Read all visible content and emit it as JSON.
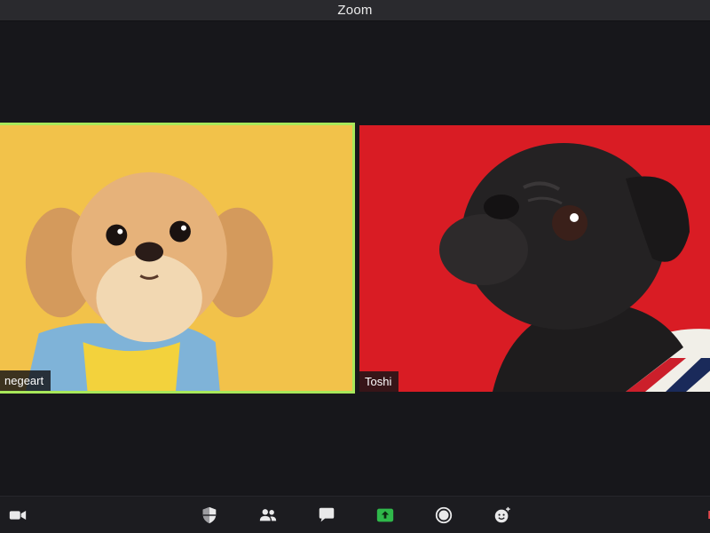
{
  "window": {
    "title": "Zoom"
  },
  "participants": [
    {
      "name": "negeart",
      "tile_color": "#f2c24a",
      "active_speaker": true,
      "highlight_color": "#a8e85a"
    },
    {
      "name": "Toshi",
      "tile_color": "#d91c24",
      "active_speaker": false
    }
  ],
  "toolbar": {
    "icons": [
      {
        "name": "video-camera-icon"
      },
      {
        "name": "security-shield-icon"
      },
      {
        "name": "participants-icon"
      },
      {
        "name": "chat-icon"
      },
      {
        "name": "share-screen-icon",
        "color": "#2fb84a"
      },
      {
        "name": "record-icon"
      },
      {
        "name": "reactions-icon"
      }
    ],
    "end_label": "E",
    "end_color": "#e5484d"
  }
}
